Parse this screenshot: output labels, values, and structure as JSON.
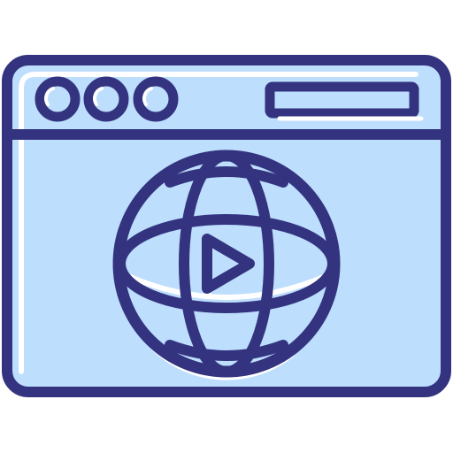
{
  "icon": {
    "name": "web-video-browser-icon",
    "colors": {
      "outline": "#33337f",
      "fill": "#bddefc",
      "highlight": "#ffffff",
      "background": "#ffffff"
    },
    "parts": [
      "browser-window-icon",
      "window-control-dot-icon",
      "address-bar-icon",
      "globe-icon",
      "play-icon"
    ]
  }
}
